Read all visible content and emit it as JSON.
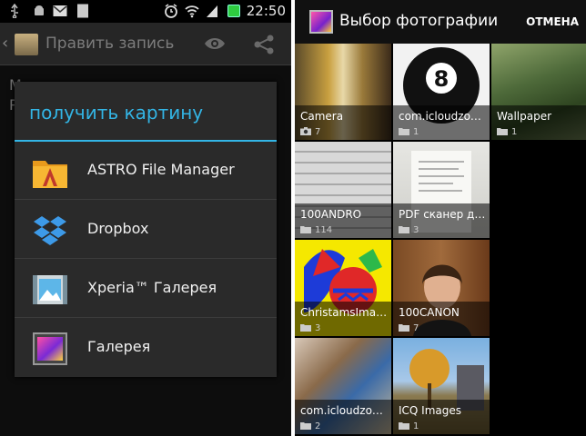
{
  "left": {
    "status_bar": {
      "time": "22:50"
    },
    "action_bar": {
      "title": "Править запись"
    },
    "background_text": [
      "М",
      "Р"
    ],
    "dialog": {
      "title": "получить картину",
      "items": [
        {
          "label": "ASTRO File Manager",
          "icon": "astro-icon"
        },
        {
          "label": "Dropbox",
          "icon": "dropbox-icon"
        },
        {
          "label": "Xperia™ Галерея",
          "icon": "xperia-gallery-icon"
        },
        {
          "label": "Галерея",
          "icon": "gallery-icon"
        }
      ]
    }
  },
  "right": {
    "header": {
      "title": "Выбор фотографии",
      "cancel_label": "ОТМЕНА"
    },
    "albums": [
      {
        "name": "Camera",
        "count": "7",
        "count_icon": "camera-icon"
      },
      {
        "name": "com.icloudzo…",
        "count": "1",
        "count_icon": "folder-icon"
      },
      {
        "name": "Wallpaper",
        "count": "1",
        "count_icon": "folder-icon"
      },
      {
        "name": "100ANDRO",
        "count": "114",
        "count_icon": "folder-icon"
      },
      {
        "name": "PDF сканер д…",
        "count": "3",
        "count_icon": "folder-icon"
      },
      {
        "name": "ChristamsIma…",
        "count": "3",
        "count_icon": "folder-icon"
      },
      {
        "name": "100CANON",
        "count": "7",
        "count_icon": "folder-icon"
      },
      {
        "name": "com.icloudzo…",
        "count": "2",
        "count_icon": "folder-icon"
      },
      {
        "name": "ICQ Images",
        "count": "1",
        "count_icon": "folder-icon"
      }
    ]
  },
  "colors": {
    "accent": "#33b5e5",
    "dialog_bg": "#2a2a2a",
    "screen_bg": "#0d0d0d"
  }
}
